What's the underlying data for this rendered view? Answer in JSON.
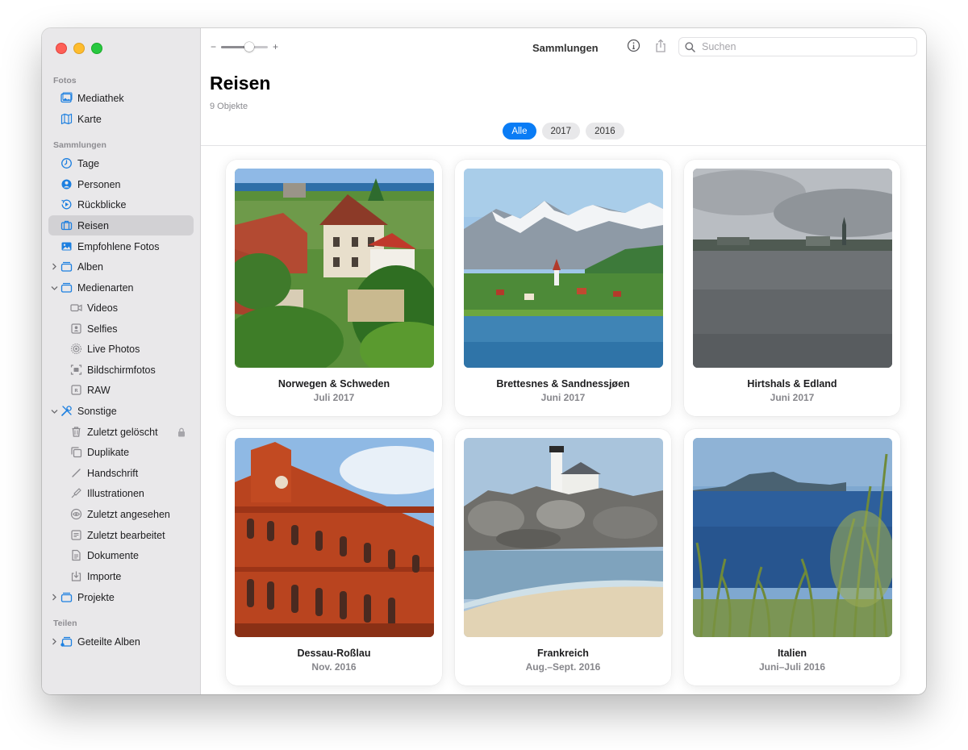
{
  "colors": {
    "accent": "#0a7cf5",
    "sidebar_bg": "#e9e8ea",
    "icon": "#1c7fe0"
  },
  "sidebar": {
    "sections": {
      "fotos": "Fotos",
      "sammlungen": "Sammlungen",
      "teilen": "Teilen"
    },
    "items": [
      {
        "label": "Mediathek",
        "icon": "photo-library-icon"
      },
      {
        "label": "Karte",
        "icon": "map-icon"
      },
      {
        "label": "Tage",
        "icon": "clock-icon"
      },
      {
        "label": "Personen",
        "icon": "person-circle-icon"
      },
      {
        "label": "Rückblicke",
        "icon": "memories-icon"
      },
      {
        "label": "Reisen",
        "icon": "suitcase-icon",
        "selected": true
      },
      {
        "label": "Empfohlene Fotos",
        "icon": "featured-photos-icon"
      },
      {
        "label": "Alben",
        "icon": "album-icon"
      },
      {
        "label": "Medienarten",
        "icon": "album-icon"
      },
      {
        "label": "Videos",
        "icon": "video-icon"
      },
      {
        "label": "Selfies",
        "icon": "selfie-icon"
      },
      {
        "label": "Live Photos",
        "icon": "live-photo-icon"
      },
      {
        "label": "Bildschirmfotos",
        "icon": "screenshot-icon"
      },
      {
        "label": "RAW",
        "icon": "raw-icon"
      },
      {
        "label": "Sonstige",
        "icon": "tools-icon"
      },
      {
        "label": "Zuletzt gelöscht",
        "icon": "trash-icon"
      },
      {
        "label": "Duplikate",
        "icon": "duplicate-icon"
      },
      {
        "label": "Handschrift",
        "icon": "pencil-icon"
      },
      {
        "label": "Illustrationen",
        "icon": "illustration-icon"
      },
      {
        "label": "Zuletzt angesehen",
        "icon": "eye-icon"
      },
      {
        "label": "Zuletzt bearbeitet",
        "icon": "edited-icon"
      },
      {
        "label": "Dokumente",
        "icon": "document-icon"
      },
      {
        "label": "Importe",
        "icon": "import-icon"
      },
      {
        "label": "Projekte",
        "icon": "album-icon"
      },
      {
        "label": "Geteilte Alben",
        "icon": "shared-album-icon"
      }
    ]
  },
  "toolbar": {
    "zoom_minus": "−",
    "zoom_plus": "+",
    "zoom_level": 0.62,
    "title": "Sammlungen",
    "search_placeholder": "Suchen"
  },
  "main": {
    "title": "Reisen",
    "count": "9 Objekte",
    "filters": [
      "Alle",
      "2017",
      "2016"
    ],
    "active_filter": "Alle",
    "cards": [
      {
        "title": "Norwegen & Schweden",
        "date": "Juli 2017"
      },
      {
        "title": "Brettesnes & Sandnessjøen",
        "date": "Juni 2017"
      },
      {
        "title": "Hirtshals & Edland",
        "date": "Juni 2017"
      },
      {
        "title": "Dessau-Roßlau",
        "date": "Nov. 2016"
      },
      {
        "title": "Frankreich",
        "date": "Aug.–Sept. 2016"
      },
      {
        "title": "Italien",
        "date": "Juni–Juli 2016"
      }
    ]
  }
}
